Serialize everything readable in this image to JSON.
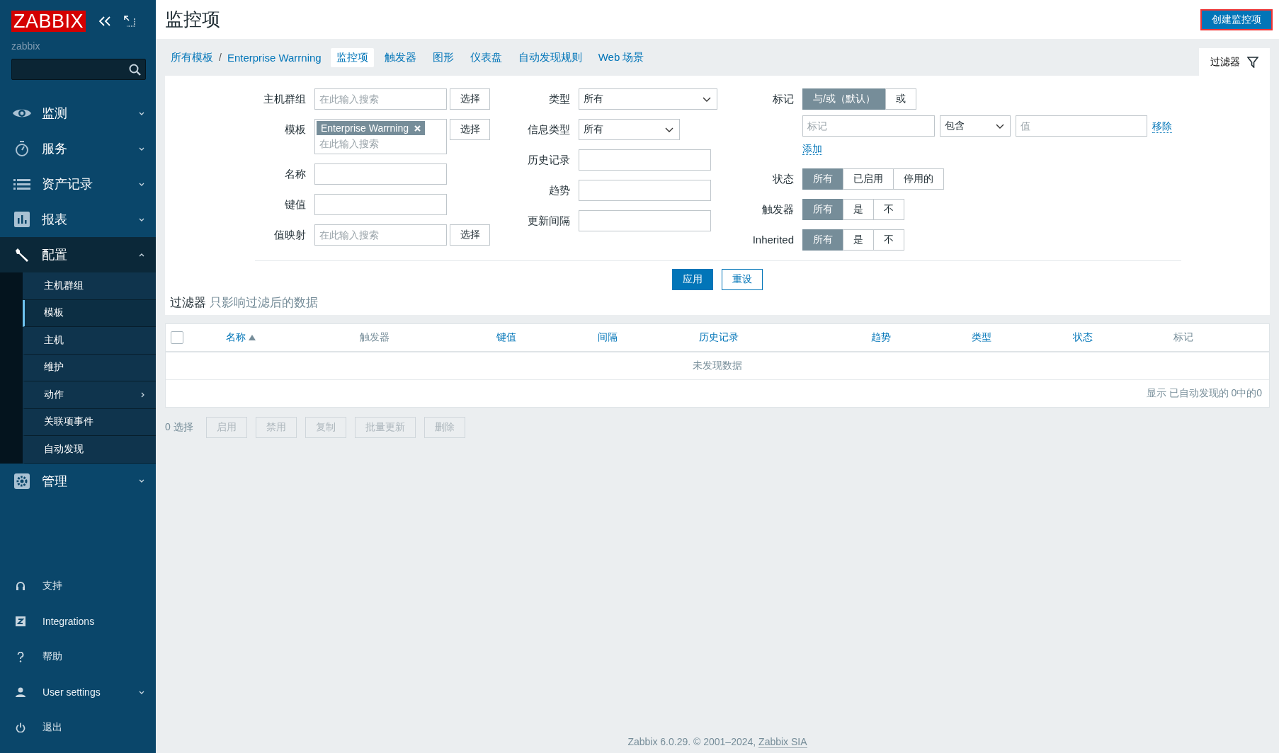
{
  "sidebar": {
    "logo": "ZABBIX",
    "server_name": "zabbix",
    "menu": [
      {
        "label": "监测",
        "expanded": false
      },
      {
        "label": "服务",
        "expanded": false
      },
      {
        "label": "资产记录",
        "expanded": false
      },
      {
        "label": "报表",
        "expanded": false
      },
      {
        "label": "配置",
        "expanded": true,
        "children": [
          {
            "label": "主机群组",
            "kind": "link",
            "selected": false
          },
          {
            "label": "模板",
            "kind": "link",
            "selected": true
          },
          {
            "label": "主机",
            "kind": "link",
            "selected": false
          },
          {
            "label": "维护",
            "kind": "link",
            "selected": false
          },
          {
            "label": "动作",
            "kind": "submenu",
            "selected": false
          },
          {
            "label": "关联项事件",
            "kind": "link",
            "selected": false
          },
          {
            "label": "自动发现",
            "kind": "link",
            "selected": false
          }
        ]
      },
      {
        "label": "管理",
        "expanded": false
      }
    ],
    "footer_menu": [
      {
        "label": "支持",
        "kind": "link"
      },
      {
        "label": "Integrations",
        "kind": "link"
      },
      {
        "label": "帮助",
        "kind": "link"
      },
      {
        "label": "User settings",
        "kind": "submenu",
        "expanded": false
      },
      {
        "label": "退出",
        "kind": "link"
      }
    ]
  },
  "page": {
    "title": "监控项",
    "create_button": "创建监控项"
  },
  "nav": {
    "breadcrumbs": [
      "所有模板",
      "Enterprise Warrning"
    ],
    "separator": "/",
    "tabs": [
      {
        "label": "监控项",
        "selected": true
      },
      {
        "label": "触发器",
        "selected": false
      },
      {
        "label": "图形",
        "selected": false
      },
      {
        "label": "仪表盘",
        "selected": false
      },
      {
        "label": "自动发现规则",
        "selected": false
      },
      {
        "label": "Web 场景",
        "selected": false
      }
    ],
    "filter_tab": {
      "label": "过滤器",
      "selected": true
    }
  },
  "filter": {
    "left": [
      {
        "label": "主机群组",
        "kind": "multiselect",
        "placeholder": "在此输入搜索",
        "button": "选择"
      },
      {
        "label": "模板",
        "kind": "multiselect",
        "tags": [
          "Enterprise Warrning"
        ],
        "placeholder": "在此输入搜索",
        "button": "选择"
      },
      {
        "label": "名称",
        "kind": "text"
      },
      {
        "label": "键值",
        "kind": "text"
      },
      {
        "label": "值映射",
        "kind": "multiselect",
        "placeholder": "在此输入搜索",
        "button": "选择"
      }
    ],
    "middle": [
      {
        "label": "类型",
        "kind": "select",
        "value": "所有"
      },
      {
        "label": "信息类型",
        "kind": "select",
        "value": "所有"
      },
      {
        "label": "历史记录",
        "kind": "text"
      },
      {
        "label": "趋势",
        "kind": "text"
      },
      {
        "label": "更新间隔",
        "kind": "text"
      }
    ],
    "tags": {
      "label": "标记",
      "operators": [
        {
          "label": "与/或（默认）",
          "selected": true
        },
        {
          "label": "或",
          "selected": false
        }
      ],
      "row": {
        "tag_placeholder": "标记",
        "operator": "包含",
        "value_placeholder": "值",
        "remove": "移除"
      },
      "add": "添加"
    },
    "toggles": [
      {
        "label": "状态",
        "options": [
          {
            "label": "所有",
            "selected": true
          },
          {
            "label": "已启用",
            "selected": false
          },
          {
            "label": "停用的",
            "selected": false
          }
        ]
      },
      {
        "label": "触发器",
        "options": [
          {
            "label": "所有",
            "selected": true
          },
          {
            "label": "是",
            "selected": false
          },
          {
            "label": "不",
            "selected": false
          }
        ]
      },
      {
        "label": "Inherited",
        "options": [
          {
            "label": "所有",
            "selected": true
          },
          {
            "label": "是",
            "selected": false
          },
          {
            "label": "不",
            "selected": false
          }
        ]
      }
    ],
    "apply": "应用",
    "reset": "重设",
    "note": {
      "title": "过滤器",
      "text": "只影响过滤后的数据"
    }
  },
  "table": {
    "select_all": {
      "checked": false
    },
    "columns": [
      {
        "label": "名称",
        "sortable": true,
        "sorted": true
      },
      {
        "label": "触发器",
        "sortable": false,
        "sorted": false
      },
      {
        "label": "键值",
        "sortable": true,
        "sorted": false
      },
      {
        "label": "间隔",
        "sortable": true,
        "sorted": false
      },
      {
        "label": "历史记录",
        "sortable": true,
        "sorted": false
      },
      {
        "label": "趋势",
        "sortable": true,
        "sorted": false
      },
      {
        "label": "类型",
        "sortable": true,
        "sorted": false
      },
      {
        "label": "状态",
        "sortable": true,
        "sorted": false
      },
      {
        "label": "标记",
        "sortable": false,
        "sorted": false
      }
    ],
    "empty_message": "未发现数据",
    "summary": "显示 已自动发现的 0中的0"
  },
  "actions": {
    "selected_count": "0 选择",
    "buttons": [
      {
        "label": "启用",
        "disabled": true
      },
      {
        "label": "禁用",
        "disabled": true
      },
      {
        "label": "复制",
        "disabled": true
      },
      {
        "label": "批量更新",
        "disabled": true
      },
      {
        "label": "删除",
        "disabled": true
      }
    ]
  },
  "footer": {
    "text": "Zabbix 6.0.29. © 2001–2024, ",
    "link": "Zabbix SIA"
  }
}
